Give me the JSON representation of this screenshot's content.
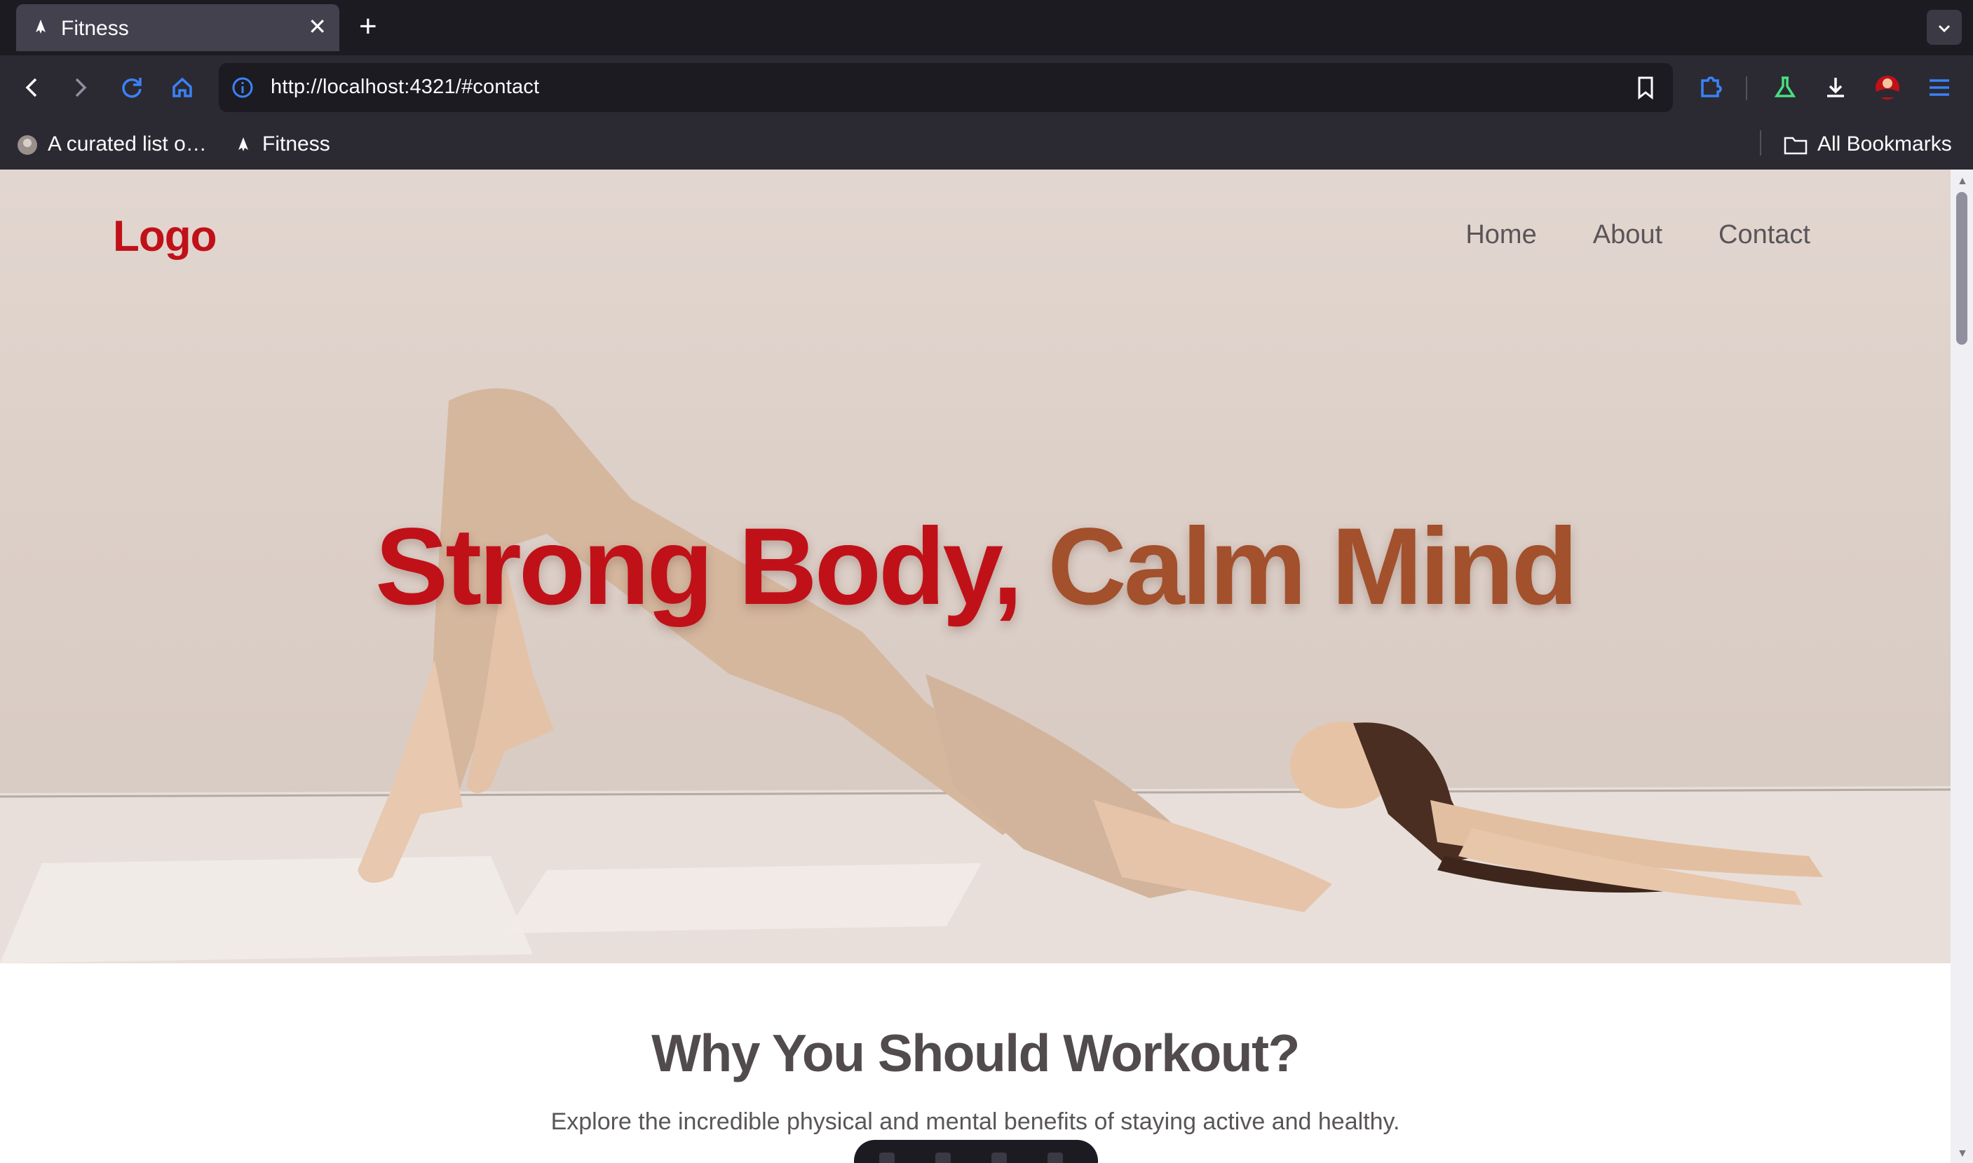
{
  "browser": {
    "tab": {
      "title": "Fitness",
      "close_glyph": "✕"
    },
    "new_tab_glyph": "+",
    "url": "http://localhost:4321/#contact",
    "bookmarks": [
      {
        "label": "A curated list o…",
        "icon": "avatar-icon"
      },
      {
        "label": "Fitness",
        "icon": "astro-icon"
      }
    ],
    "all_bookmarks_label": "All Bookmarks",
    "accent_color": "#3b82f6"
  },
  "site": {
    "logo": "Logo",
    "nav": [
      "Home",
      "About",
      "Contact"
    ],
    "hero": {
      "title_part1": "Strong Body,",
      "title_part2": "Calm Mind"
    },
    "section": {
      "title": "Why You Should Workout?",
      "subtitle": "Explore the incredible physical and mental benefits of staying active and healthy."
    },
    "colors": {
      "primary": "#c01119",
      "secondary": "#a3502c",
      "text": "#514b4e"
    }
  }
}
